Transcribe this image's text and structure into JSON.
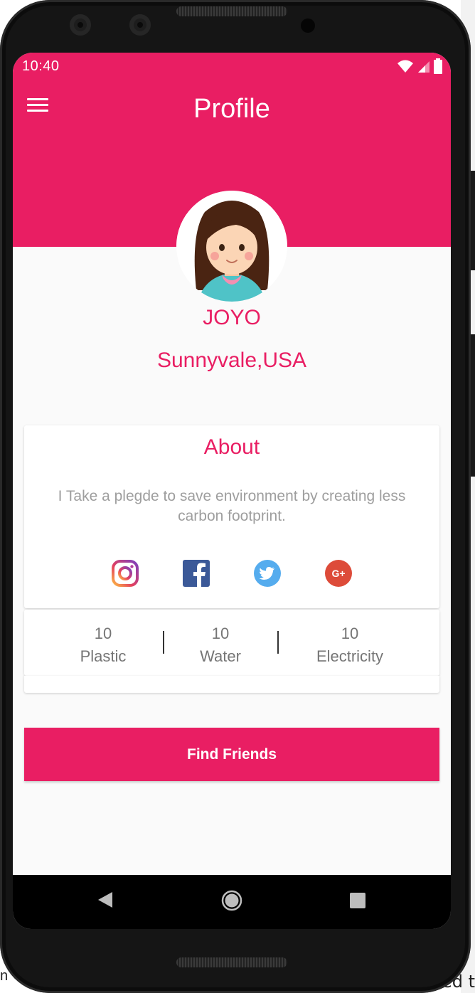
{
  "status_bar": {
    "time": "10:40"
  },
  "app_bar": {
    "title": "Profile"
  },
  "profile": {
    "name": "JOYO",
    "location": "Sunnyvale,USA"
  },
  "about": {
    "title": "About",
    "text": "I Take a plegde to save environment by creating less carbon footprint."
  },
  "socials": [
    "instagram-icon",
    "facebook-icon",
    "twitter-icon",
    "google-plus-icon"
  ],
  "stats": [
    {
      "value": "10",
      "label": "Plastic"
    },
    {
      "value": "10",
      "label": "Water"
    },
    {
      "value": "10",
      "label": "Electricity"
    }
  ],
  "actions": {
    "find_friends": "Find Friends"
  },
  "colors": {
    "primary": "#e91e63",
    "background": "#fafafa",
    "text_muted": "#9e9e9e",
    "stat_text": "#757575"
  },
  "background_window": {
    "right_text": "ed t",
    "left_text": "n"
  }
}
